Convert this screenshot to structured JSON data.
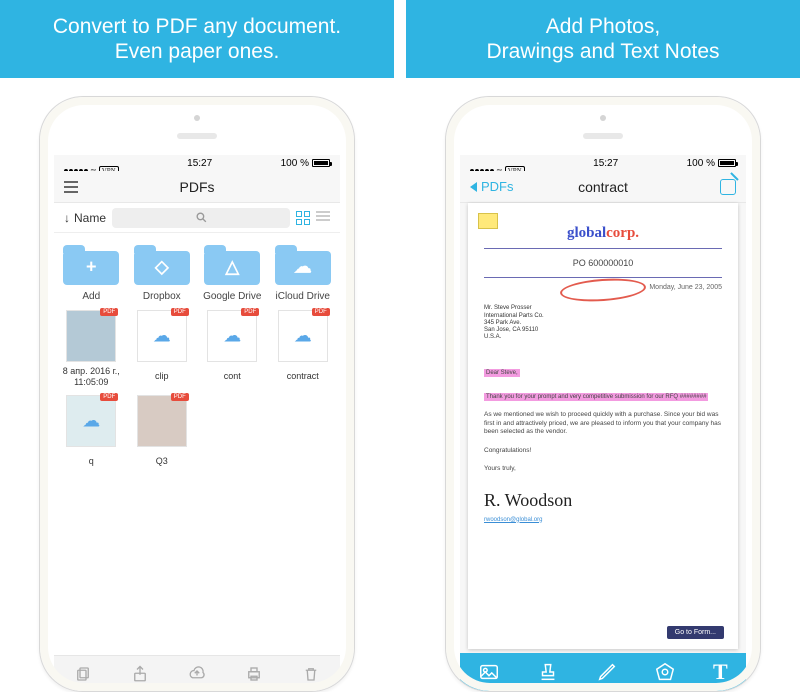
{
  "panels": [
    {
      "headline_l1": "Convert to PDF any document.",
      "headline_l2": "Even paper ones."
    },
    {
      "headline_l1": "Add Photos,",
      "headline_l2": "Drawings and Text Notes"
    }
  ],
  "status": {
    "carrier_vpn": "VPN",
    "time": "15:27",
    "battery": "100 %"
  },
  "screen1": {
    "nav_title": "PDFs",
    "sort_label": "Name",
    "folders": [
      {
        "label": "Add",
        "icon": "plus"
      },
      {
        "label": "Dropbox",
        "icon": "dropbox"
      },
      {
        "label": "Google Drive",
        "icon": "gdrive"
      },
      {
        "label": "iCloud Drive",
        "icon": "cloud"
      }
    ],
    "files_row1": [
      {
        "label": "8 апр. 2016 г., 11:05:09"
      },
      {
        "label": "clip"
      },
      {
        "label": "cont"
      },
      {
        "label": "contract"
      }
    ],
    "files_row2": [
      {
        "label": "q"
      },
      {
        "label": "Q3"
      }
    ]
  },
  "screen2": {
    "back_label": "PDFs",
    "nav_title": "contract",
    "logo_part1": "global",
    "logo_part2": "corp.",
    "po_number": "PO 600000010",
    "date": "Monday, June 23, 2005",
    "address_block": "Mr. Steve Prosser\nInternational Parts Co.\n345 Park Ave.\nSan Jose, CA 95110\nU.S.A.",
    "salutation": "Dear Steve,",
    "highlight_line": "Thank you for your prompt and very competitive submission for our RFQ ########",
    "body_para": "As we mentioned we wish to proceed quickly with a purchase. Since your bid was first in and attractively priced, we are pleased to inform you that your company has been selected as the vendor.",
    "congrats": "Congratulations!",
    "closing": "Yours truly,",
    "signature": "R. Woodson",
    "link_line": "rwoodson@global.org",
    "goto_btn": "Go to Form...",
    "toolbar_text": "T"
  }
}
